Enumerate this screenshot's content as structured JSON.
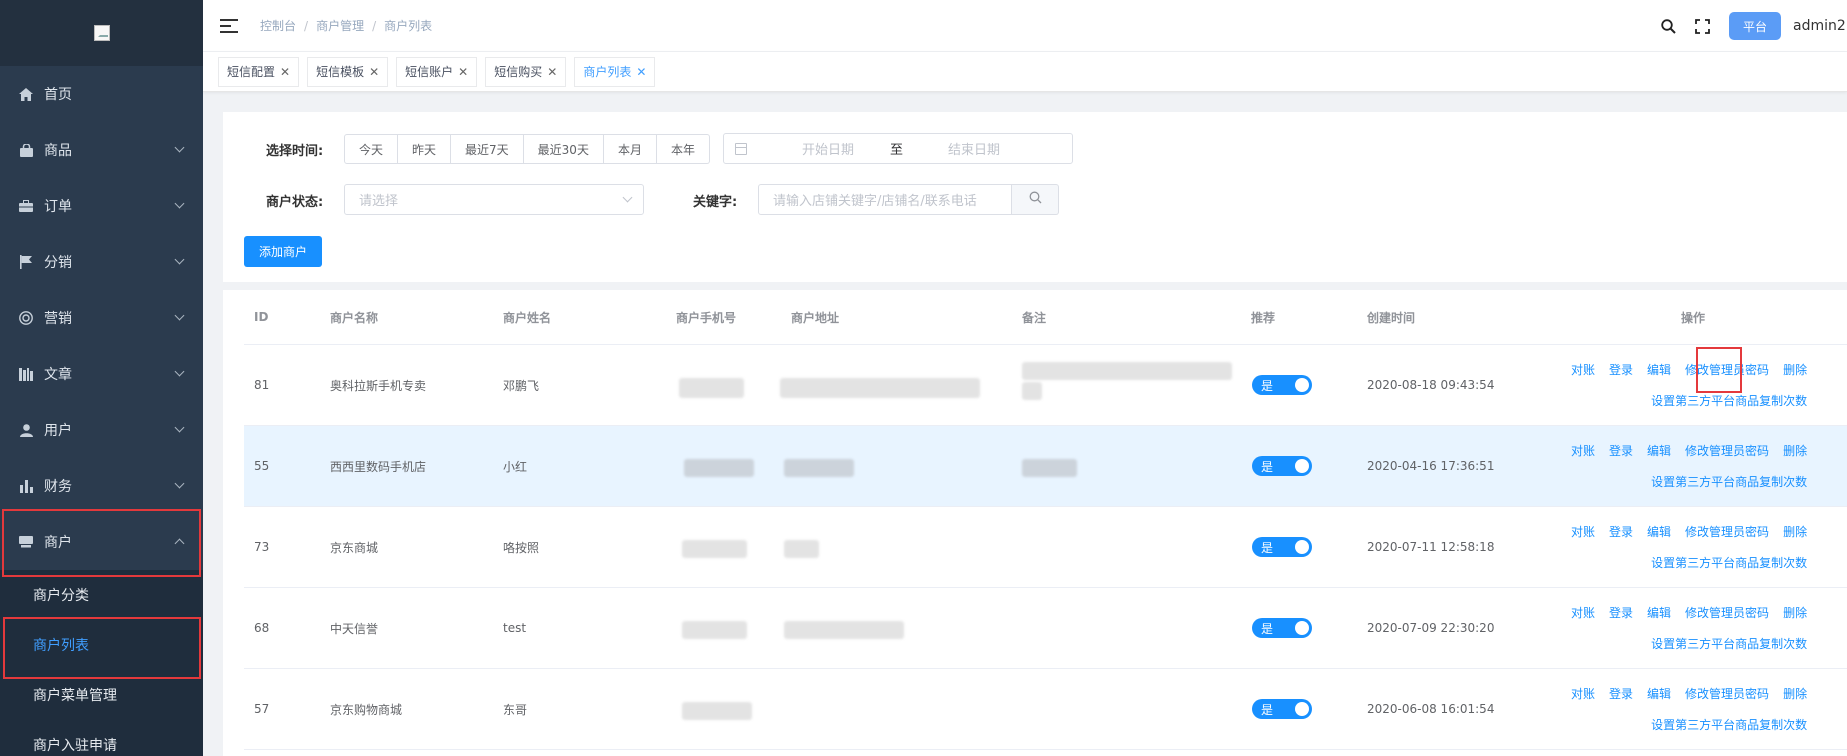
{
  "sidebar": {
    "items": [
      {
        "label": "首页",
        "icon": "home-icon",
        "expandable": false
      },
      {
        "label": "商品",
        "icon": "bag-icon",
        "expandable": true
      },
      {
        "label": "订单",
        "icon": "briefcase-icon",
        "expandable": true
      },
      {
        "label": "分销",
        "icon": "flag-icon",
        "expandable": true
      },
      {
        "label": "营销",
        "icon": "target-icon",
        "expandable": true
      },
      {
        "label": "文章",
        "icon": "book-icon",
        "expandable": true
      },
      {
        "label": "用户",
        "icon": "user-icon",
        "expandable": true
      },
      {
        "label": "财务",
        "icon": "bar-chart-icon",
        "expandable": true
      },
      {
        "label": "商户",
        "icon": "store-icon",
        "expandable": true,
        "expanded": true
      }
    ],
    "sub_items": [
      {
        "label": "商户分类",
        "active": false
      },
      {
        "label": "商户列表",
        "active": true
      },
      {
        "label": "商户菜单管理",
        "active": false
      },
      {
        "label": "商户入驻申请",
        "active": false
      }
    ]
  },
  "header": {
    "breadcrumb": [
      "控制台",
      "商户管理",
      "商户列表"
    ],
    "platform_label": "平台",
    "user_name": "admin2"
  },
  "tags": [
    {
      "label": "短信配置",
      "active": false
    },
    {
      "label": "短信模板",
      "active": false
    },
    {
      "label": "短信账户",
      "active": false
    },
    {
      "label": "短信购买",
      "active": false
    },
    {
      "label": "商户列表",
      "active": true
    }
  ],
  "filters": {
    "time_label": "选择时间:",
    "time_options": [
      "今天",
      "昨天",
      "最近7天",
      "最近30天",
      "本月",
      "本年"
    ],
    "start_placeholder": "开始日期",
    "range_sep": "至",
    "end_placeholder": "结束日期",
    "status_label": "商户状态:",
    "status_placeholder": "请选择",
    "keyword_label": "关键字:",
    "keyword_placeholder": "请输入店铺关键字/店铺名/联系电话",
    "add_button": "添加商户"
  },
  "table": {
    "columns": [
      "ID",
      "商户名称",
      "商户姓名",
      "商户手机号",
      "商户地址",
      "备注",
      "推荐",
      "创建时间",
      "操作"
    ],
    "rows": [
      {
        "id": "81",
        "name": "奥科拉斯手机专卖",
        "person": "邓鹏飞",
        "recommend": "是",
        "created": "2020-08-18 09:43:54"
      },
      {
        "id": "55",
        "name": "西西里数码手机店",
        "person": "小红",
        "recommend": "是",
        "created": "2020-04-16 17:36:51"
      },
      {
        "id": "73",
        "name": "京东商城",
        "person": "咯按照",
        "recommend": "是",
        "created": "2020-07-11 12:58:18"
      },
      {
        "id": "68",
        "name": "中天信誉",
        "person": "test",
        "recommend": "是",
        "created": "2020-07-09 22:30:20"
      },
      {
        "id": "57",
        "name": "京东购物商城",
        "person": "东哥",
        "recommend": "是",
        "created": "2020-06-08 16:01:54"
      }
    ],
    "actions": {
      "reconcile": "对账",
      "login": "登录",
      "edit": "编辑",
      "change_password": "修改管理员密码",
      "delete": "删除",
      "set_copy_count": "设置第三方平台商品复制次数"
    }
  },
  "colors": {
    "sidebar_bg": "#2b3b4e",
    "accent": "#1890ff",
    "highlight_red": "#e4393c"
  }
}
